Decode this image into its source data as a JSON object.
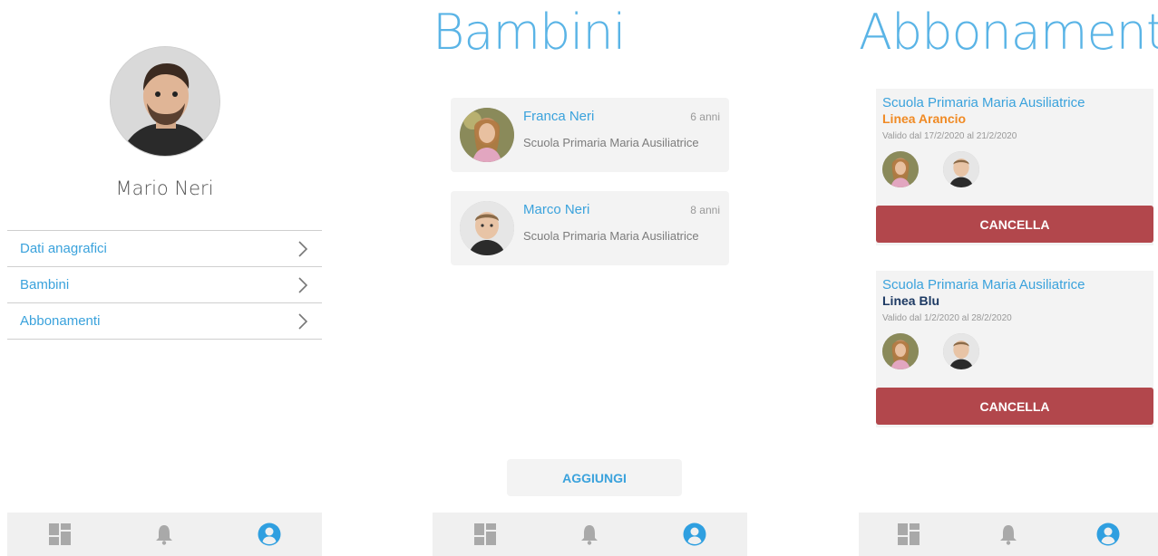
{
  "profile": {
    "name": "Mario Neri",
    "menu": [
      {
        "label": "Dati anagrafici"
      },
      {
        "label": "Bambini"
      },
      {
        "label": "Abbonamenti"
      }
    ]
  },
  "kids_screen": {
    "title": "Bambini",
    "kids": [
      {
        "name": "Franca Neri",
        "age": "6 anni",
        "school": "Scuola Primaria Maria Ausiliatrice"
      },
      {
        "name": "Marco Neri",
        "age": "8 anni",
        "school": "Scuola Primaria Maria Ausiliatrice"
      }
    ],
    "add_label": "AGGIUNGI"
  },
  "subs_screen": {
    "title": "Abbonamenti",
    "subs": [
      {
        "school": "Scuola Primaria Maria Ausiliatrice",
        "line": "Linea Arancio",
        "line_color": "#f08a24",
        "valid": "Valido dal 17/2/2020 al 21/2/2020",
        "cancel_label": "CANCELLA"
      },
      {
        "school": "Scuola Primaria Maria Ausiliatrice",
        "line": "Linea Blu",
        "line_color": "#1d3a63",
        "valid": "Valido dal 1/2/2020 al 28/2/2020",
        "cancel_label": "CANCELLA"
      }
    ]
  },
  "tabbar": {
    "icons": [
      "dashboard-icon",
      "bell-icon",
      "user-circle-icon"
    ],
    "active": "user-circle-icon",
    "active_color": "#2f9fe0",
    "inactive_color": "#a9a9a9"
  },
  "colors": {
    "accent": "#3aa2dc",
    "title": "#5ab4e6",
    "cancel": "#b2474c"
  }
}
